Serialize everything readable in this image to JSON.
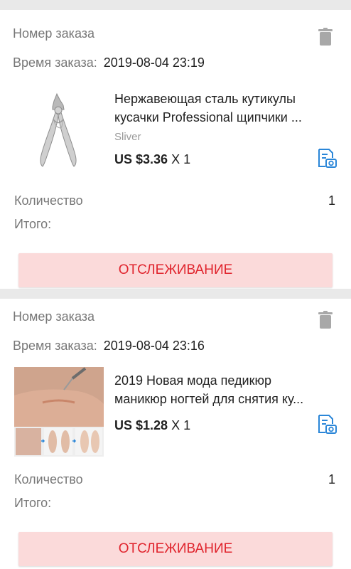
{
  "orders": [
    {
      "order_number_label": "Номер заказа",
      "order_time_label": "Время заказа:",
      "order_time": "2019-08-04 23:19",
      "product_title_line1": "Нержавеющая сталь кутикулы",
      "product_title_line2": "кусачки Professional щипчики ...",
      "variant": "Sliver",
      "price": "US $3.36",
      "quantity_suffix": "X 1",
      "quantity_label": "Количество",
      "quantity_value": "1",
      "total_label": "Итого:",
      "track_button_label": "ОТСЛЕЖИВАНИЕ",
      "product_icon": "cuticle-nipper-image"
    },
    {
      "order_number_label": "Номер заказа",
      "order_time_label": "Время заказа:",
      "order_time": "2019-08-04 23:16",
      "product_title_line1": "2019 Новая мода педикюр",
      "product_title_line2": "маникюр ногтей для снятия ку...",
      "price": "US $1.28",
      "quantity_suffix": "X 1",
      "quantity_label": "Количество",
      "quantity_value": "1",
      "total_label": "Итого:",
      "track_button_label": "ОТСЛЕЖИВАНИЕ",
      "product_icon": "pedicure-foot-image"
    }
  ],
  "colors": {
    "accent": "#e0242d",
    "button_bg": "#fbdada",
    "link_blue": "#2a86d8",
    "label_gray": "#777777"
  }
}
